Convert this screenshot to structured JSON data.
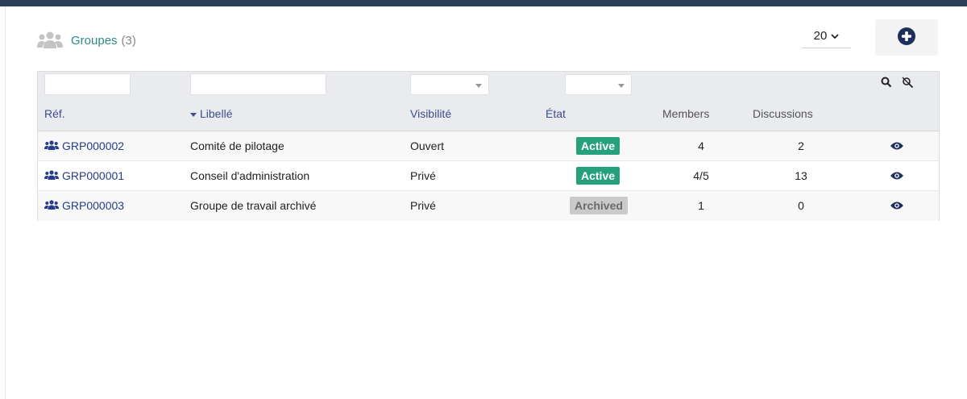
{
  "header": {
    "title": "Groupes",
    "count": "(3)",
    "page_size": "20",
    "icons": {
      "title": "users-group-icon",
      "page_size": "chevron-down-icon",
      "add": "plus-circle-icon"
    }
  },
  "toolbar": {
    "search_icon": "search-icon",
    "clear_icon": "clear-filter-icon"
  },
  "filters": {
    "ref": {
      "value": ""
    },
    "libelle": {
      "value": ""
    },
    "visibilite": {
      "value": ""
    },
    "etat": {
      "value": ""
    }
  },
  "columns": {
    "ref": "Réf.",
    "libelle": "Libellé",
    "visibilite": "Visibilité",
    "etat": "État",
    "members": "Members",
    "discussions": "Discussions"
  },
  "rows": [
    {
      "ref": "GRP000002",
      "libelle": "Comité de pilotage",
      "visibilite": "Ouvert",
      "etat": "Active",
      "members": "4",
      "discussions": "2"
    },
    {
      "ref": "GRP000001",
      "libelle": "Conseil d'administration",
      "visibilite": "Privé",
      "etat": "Active",
      "members": "4/5",
      "discussions": "13"
    },
    {
      "ref": "GRP000003",
      "libelle": "Groupe de travail archivé",
      "visibilite": "Privé",
      "etat": "Archived",
      "members": "1",
      "discussions": "0"
    }
  ],
  "colors": {
    "topbar": "#2c3e55",
    "title": "#2a8a8a",
    "link": "#263c8a",
    "badge_active": "#27a07c",
    "badge_archived": "#c9cacb",
    "add_icon": "#1f2f5c"
  },
  "row_icons": {
    "ref": "users-icon",
    "action": "eye-icon"
  }
}
